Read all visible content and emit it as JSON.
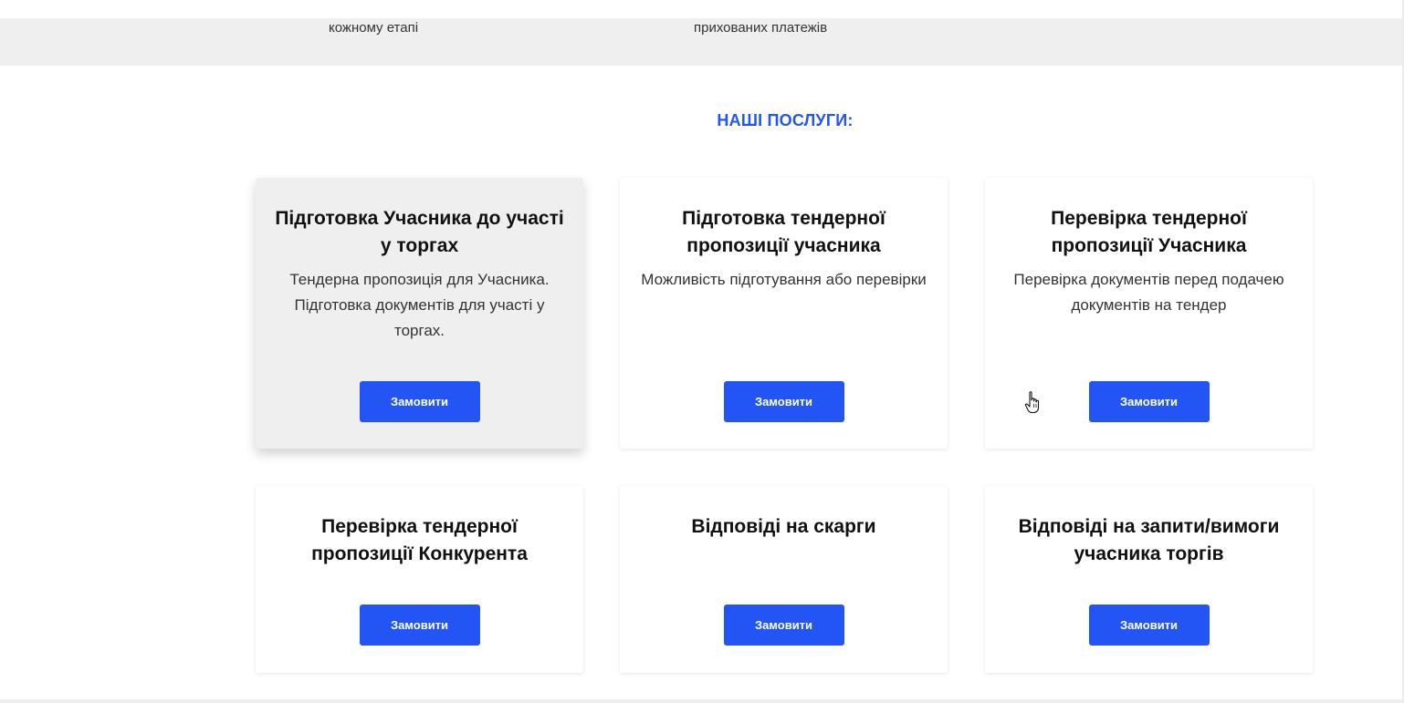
{
  "features": [
    {
      "text": "кожному етапі"
    },
    {
      "text": "прихованих платежів"
    }
  ],
  "section": {
    "title": "НАШІ ПОСЛУГИ:"
  },
  "services": [
    {
      "title": "Підготовка Учасника до участі у торгах",
      "description": "Тендерна пропозиція для Учасника. Підготовка документів для участі у торгах.",
      "button_label": "Замовити"
    },
    {
      "title": "Підготовка тендерної пропозиції учасника",
      "description": "Можливість підготування або перевірки",
      "button_label": "Замовити"
    },
    {
      "title": "Перевірка тендерної пропозиції Учасника",
      "description": "Перевірка документів перед подачею документів на тендер",
      "button_label": "Замовити"
    },
    {
      "title": "Перевірка тендерної пропозиції Конкурента",
      "description": "",
      "button_label": "Замовити"
    },
    {
      "title": "Відповіді на скарги",
      "description": "",
      "button_label": "Замовити"
    },
    {
      "title": "Відповіді на запити/вимоги учасника торгів",
      "description": "",
      "button_label": "Замовити"
    }
  ],
  "colors": {
    "accent": "#2355f5",
    "band": "#efefef"
  },
  "icons": {
    "cursor": "hand-pointer-icon"
  }
}
